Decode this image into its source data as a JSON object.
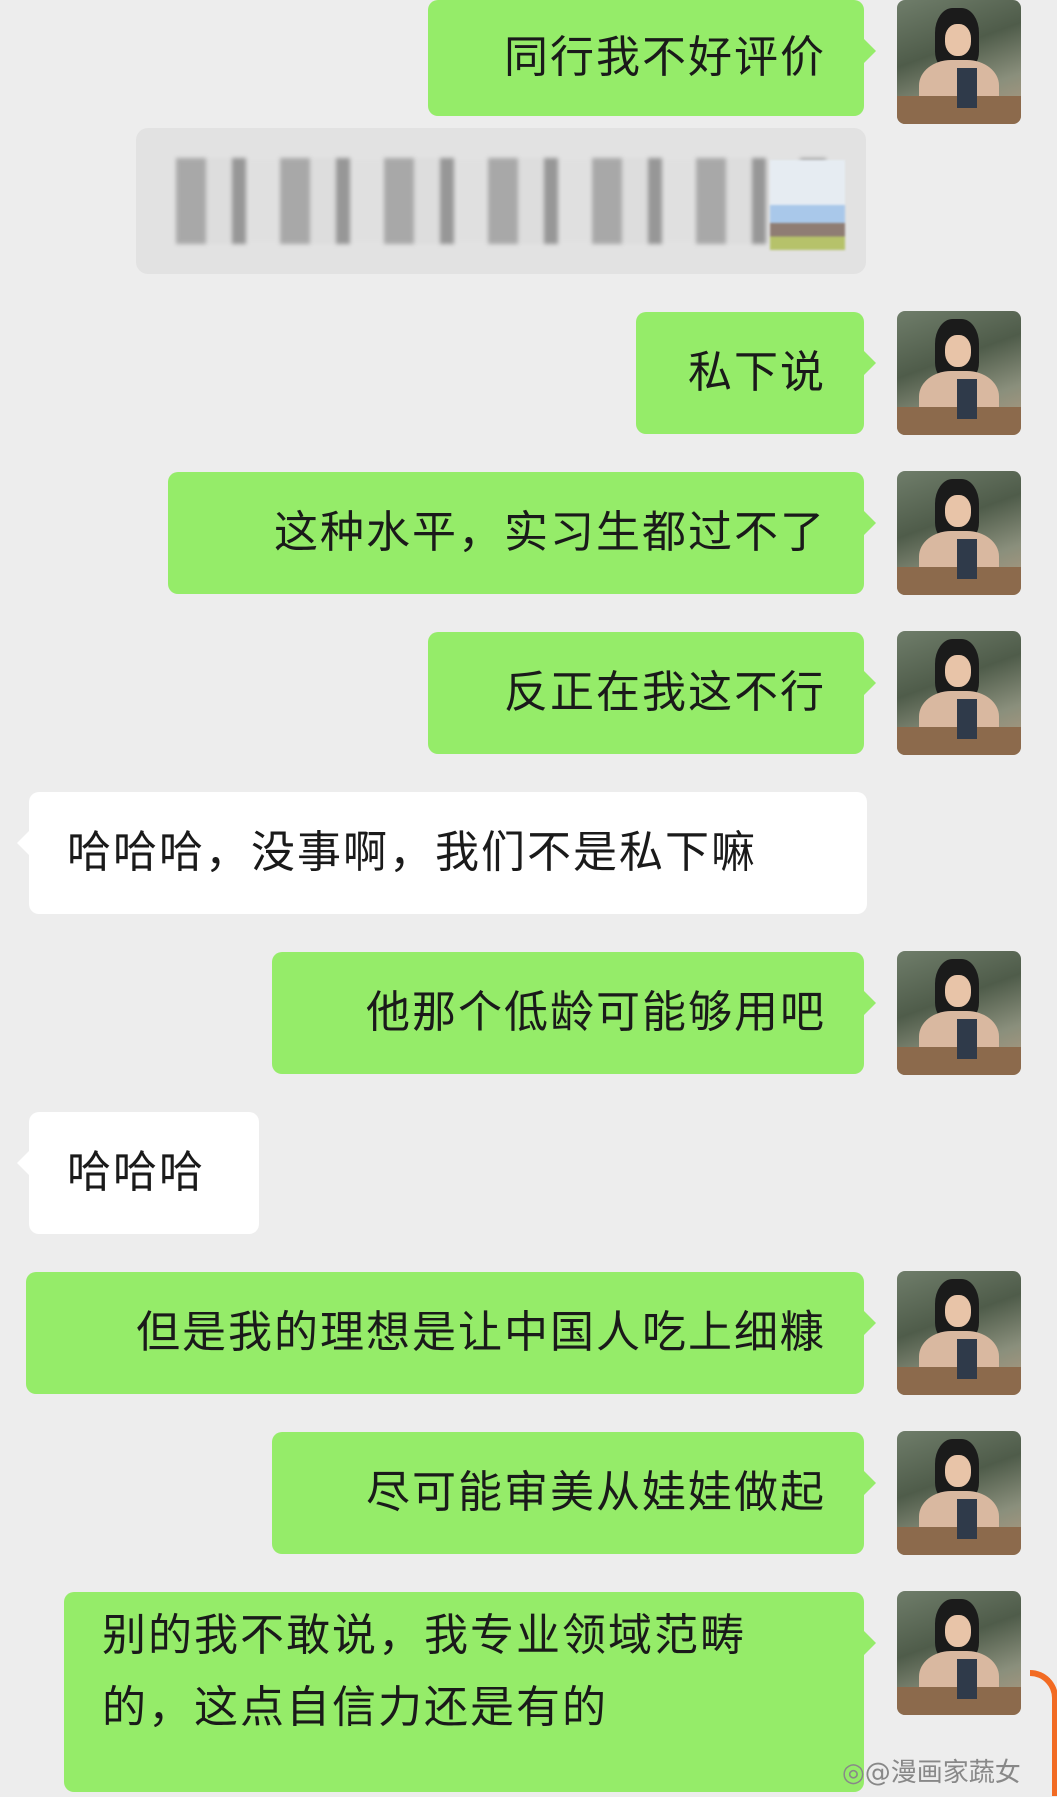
{
  "messages": [
    {
      "from": "me",
      "text": "同行我不好评价"
    },
    {
      "from": "me",
      "text": "私下说"
    },
    {
      "from": "me",
      "text": "这种水平，实习生都过不了"
    },
    {
      "from": "me",
      "text": "反正在我这不行"
    },
    {
      "from": "them",
      "text": "哈哈哈，没事啊，我们不是私下嘛"
    },
    {
      "from": "me",
      "text": "他那个低龄可能够用吧"
    },
    {
      "from": "them",
      "text": "哈哈哈"
    },
    {
      "from": "me",
      "text": "但是我的理想是让中国人吃上细糠"
    },
    {
      "from": "me",
      "text": "尽可能审美从娃娃做起"
    },
    {
      "from": "me",
      "text": "别的我不敢说，我专业领域范畴的，这点自信力还是有的"
    }
  ],
  "watermark": "@漫画家蔬女",
  "watermark_icon": "weibo-icon",
  "colors": {
    "my_bubble": "#95ec69",
    "their_bubble": "#ffffff",
    "background": "#ededed"
  }
}
